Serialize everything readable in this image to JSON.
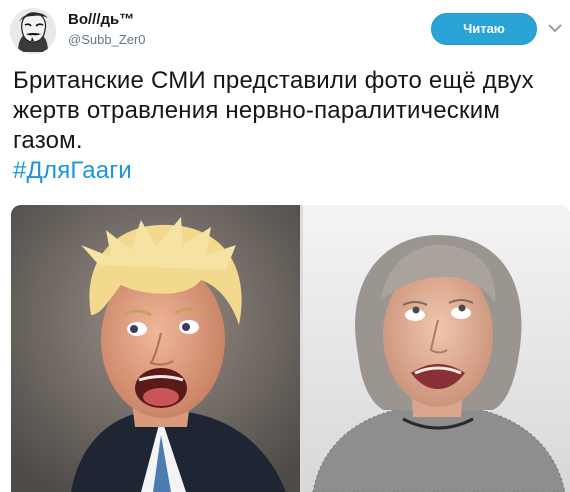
{
  "tweet": {
    "author": {
      "display_name": "Bo///дь™",
      "username": "@Subb_Zer0",
      "avatar_icon": "anonymous-mask-avatar"
    },
    "follow_button_label": "Читаю",
    "menu_icon": "chevron-down-icon",
    "text": "Британские СМИ представили фото ещё двух жертв отравления нервно-паралитическим газом.",
    "hashtag": "#ДляГааги",
    "colors": {
      "accent": "#2aa3d6",
      "link": "#1b95e0",
      "text": "#14171a",
      "muted": "#657786"
    }
  }
}
